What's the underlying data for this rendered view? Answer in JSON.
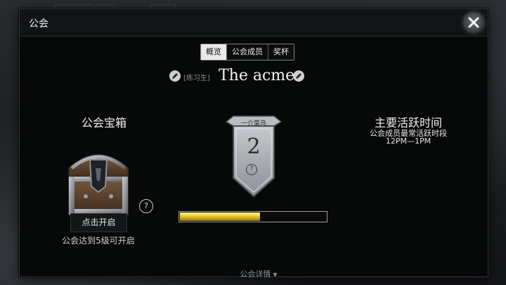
{
  "window": {
    "title": "公会"
  },
  "tabs": [
    {
      "label": "概览",
      "active": true
    },
    {
      "label": "公会成员",
      "active": false
    },
    {
      "label": "奖杯",
      "active": false
    }
  ],
  "guild": {
    "rank_tag": "[练习生]",
    "name": "The acme"
  },
  "chest": {
    "title": "公会宝箱",
    "open_button": "点击开启",
    "unlock_hint": "公会达到5级可开启",
    "help": "?"
  },
  "tier": {
    "label": "一介菜鸟",
    "rank_number": "2",
    "help": "?",
    "progress_fraction": 0.55
  },
  "active_time": {
    "title": "主要活跃时间",
    "subtitle": "公会成员最常活跃时段",
    "range": "12PM—1PM"
  },
  "footer": {
    "details_label": "公会详情"
  },
  "icons": {
    "close": "close-x-icon",
    "edit": "pencil-icon",
    "chest": "treasure-chest-icon",
    "emblem": "shield-banner-icon",
    "caret": "caret-down-icon"
  },
  "colors": {
    "progress_fill": "#e8c62a",
    "panel_bg": "#070808",
    "active_tab": "#e9e9e9"
  }
}
